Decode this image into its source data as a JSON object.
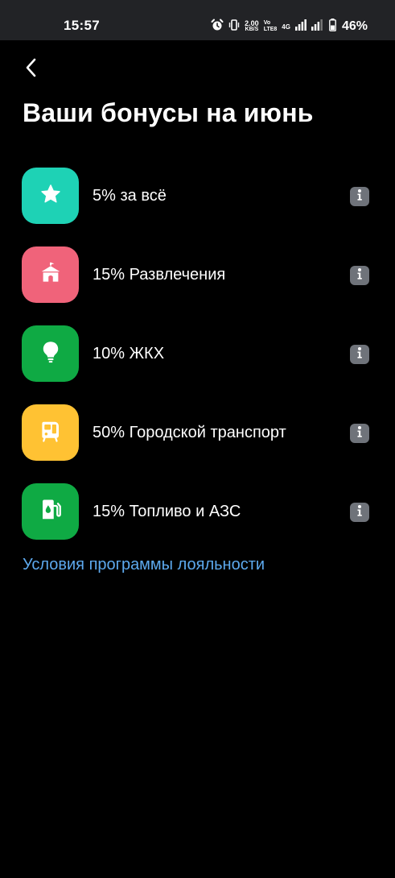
{
  "status_bar": {
    "time": "15:57",
    "net_speed": "2.00",
    "net_speed_unit": "KB/S",
    "volte_top": "Vo",
    "volte_bottom": "LTE8",
    "network_type": "4G",
    "battery": "46%"
  },
  "header": {
    "title": "Ваши бонусы на июнь"
  },
  "bonuses": [
    {
      "label": "5% за всё",
      "icon": "star-icon",
      "color": "#1ed2b5"
    },
    {
      "label": "15% Развлечения",
      "icon": "circus-tent-icon",
      "color": "#f0637a"
    },
    {
      "label": "10% ЖКХ",
      "icon": "lightbulb-icon",
      "color": "#0faa44"
    },
    {
      "label": "50% Городской транспорт",
      "icon": "tram-icon",
      "color": "#ffc233"
    },
    {
      "label": "15% Топливо и АЗС",
      "icon": "fuel-pump-icon",
      "color": "#0faa44"
    }
  ],
  "footer": {
    "loyalty_link": "Условия программы лояльности"
  },
  "colors": {
    "background": "#000000",
    "status_bar": "#222326",
    "link": "#5da9ee",
    "info_button": "#6f737a"
  }
}
